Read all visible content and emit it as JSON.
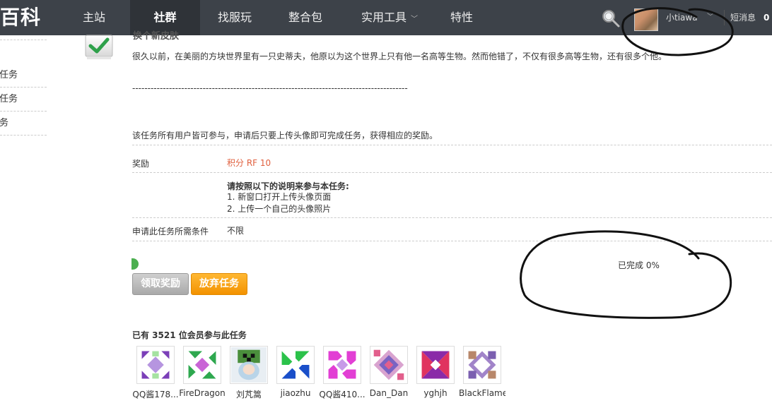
{
  "header": {
    "logo_text": "百科",
    "nav": [
      {
        "label": "主站"
      },
      {
        "label": "社群",
        "active": true
      },
      {
        "label": "找服玩"
      },
      {
        "label": "整合包"
      },
      {
        "label": "实用工具",
        "dropdown": true
      },
      {
        "label": "特性"
      }
    ],
    "username": "小tiawa",
    "messages_label": "短消息",
    "messages_count": "0"
  },
  "sidebar": {
    "items": [
      {
        "label": "的任务"
      },
      {
        "label": "的任务"
      },
      {
        "label": "任务"
      }
    ]
  },
  "task": {
    "title": "换个新皮肤",
    "description": "很久以前，在美丽的方块世界里有一只史蒂夫，他原以为这个世界上只有他一名高等生物。然而他错了，不仅有很多高等生物，还有很多个他。",
    "divider_text": "------------------------------------------------------------------------------------------",
    "note": "该任务所有用户皆可参与，申请后只要上传头像即可完成任务，获得相应的奖励。",
    "reward_label": "奖励",
    "reward_value": "积分 RF 10",
    "steps_title": "请按照以下的说明来参与本任务:",
    "steps": [
      "1. 新窗口打开上传头像页面",
      "2. 上传一个自己的头像照片"
    ],
    "condition_label": "申请此任务所需条件",
    "condition_value": "不限",
    "progress_text": "已完成 0%",
    "progress_value": 0,
    "claim_button": "领取奖励",
    "abandon_button": "放弃任务"
  },
  "participants": {
    "title": "已有 3521 位会员参与此任务",
    "members": [
      {
        "name": "QQ酱178..."
      },
      {
        "name": "FireDragon"
      },
      {
        "name": "刘芃篙"
      },
      {
        "name": "jiaozhu"
      },
      {
        "name": "QQ酱410..."
      },
      {
        "name": "Dan_Dan"
      },
      {
        "name": "yghjh"
      },
      {
        "name": "BlackFlame"
      }
    ]
  },
  "colors": {
    "nav_bg": "#3d4249",
    "nav_active_bg": "#2f3338",
    "reward_color": "#e0603f",
    "abandon_button": "#f39200",
    "claim_button": "#a9a9a9",
    "progress": "#4caf50"
  }
}
